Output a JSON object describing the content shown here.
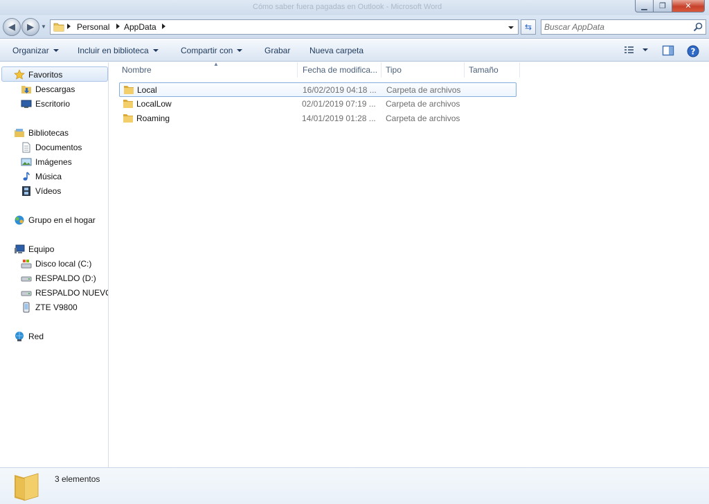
{
  "window": {
    "ghost_title": "Cómo saber fuera pagadas en Outlook - Microsoft Word"
  },
  "address": {
    "crumbs": [
      "Personal",
      "AppData"
    ],
    "search_placeholder": "Buscar AppData"
  },
  "toolbar": {
    "organize": "Organizar",
    "include_library": "Incluir en biblioteca",
    "share_with": "Compartir con",
    "burn": "Grabar",
    "new_folder": "Nueva carpeta"
  },
  "nav": {
    "favorites": "Favoritos",
    "downloads": "Descargas",
    "desktop": "Escritorio",
    "libraries": "Bibliotecas",
    "documents": "Documentos",
    "images": "Imágenes",
    "music": "Música",
    "videos": "Vídeos",
    "homegroup": "Grupo en el hogar",
    "computer": "Equipo",
    "drive_c": "Disco local (C:)",
    "drive_d": "RESPALDO (D:)",
    "drive_e": "RESPALDO NUEVO (",
    "phone": "ZTE V9800",
    "network": "Red"
  },
  "columns": {
    "name": "Nombre",
    "date": "Fecha de modifica...",
    "type": "Tipo",
    "size": "Tamaño"
  },
  "files": [
    {
      "name": "Local",
      "date": "16/02/2019 04:18 ...",
      "type": "Carpeta de archivos"
    },
    {
      "name": "LocalLow",
      "date": "02/01/2019 07:19 ...",
      "type": "Carpeta de archivos"
    },
    {
      "name": "Roaming",
      "date": "14/01/2019 01:28 ...",
      "type": "Carpeta de archivos"
    }
  ],
  "status": {
    "count": "3 elementos"
  },
  "colors": {
    "accent": "#1e395b",
    "selection_border": "#84acdd",
    "folder": "#e8c35a"
  }
}
